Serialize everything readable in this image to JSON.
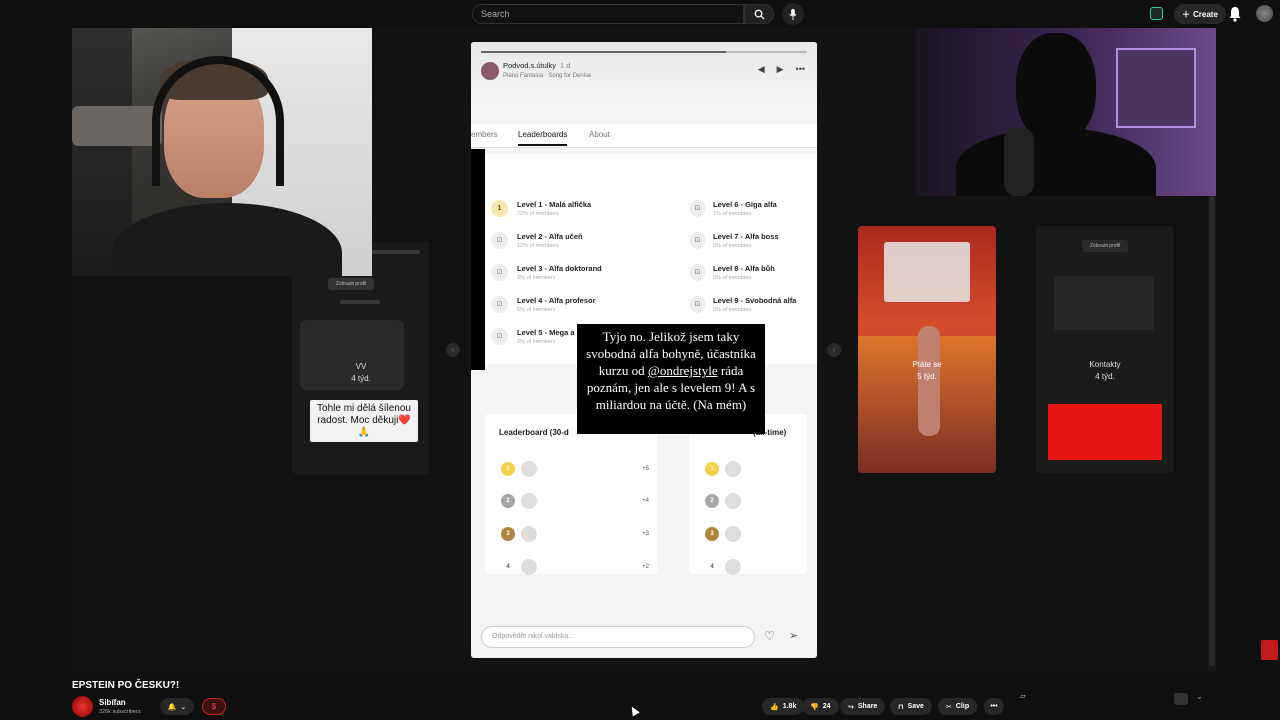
{
  "topbar": {
    "search_placeholder": "Search",
    "create_label": "Create",
    "icons": [
      "search-icon",
      "mic-icon",
      "extension-icon",
      "bell-icon",
      "profile-avatar"
    ]
  },
  "story": {
    "username": "Podvod.s.útulky",
    "time": "1 d",
    "song": "Piano Fantasia · Song for Denise",
    "tabs": [
      "embers",
      "Leaderboards",
      "About"
    ],
    "levels_left": [
      {
        "name": "Level 1 - Malá alfička",
        "sub": "72% of members",
        "icon": "1"
      },
      {
        "name": "Level 2 - Alfa učeň",
        "sub": "12% of members",
        "icon": "lock"
      },
      {
        "name": "Level 3 - Alfa doktorand",
        "sub": "8% of members",
        "icon": "lock"
      },
      {
        "name": "Level 4 - Alfa profesor",
        "sub": "5% of members",
        "icon": "lock"
      },
      {
        "name": "Level 5 - Mega a",
        "sub": "2% of members",
        "icon": "lock"
      }
    ],
    "levels_right": [
      {
        "name": "Level 6 - Giga alfa",
        "sub": "1% of members",
        "icon": "lock"
      },
      {
        "name": "Level 7 - Alfa boss",
        "sub": "0% of members",
        "icon": "lock"
      },
      {
        "name": "Level 8 - Alfa bůh",
        "sub": "0% of members",
        "icon": "lock"
      },
      {
        "name": "Level 9 - Svobodná alfa",
        "sub": "0% of members",
        "icon": "lock"
      }
    ],
    "overlay_text_pre": "Tyjo no. Jelikož jsem taky svobodná alfa bohyně, účastníka kurzu od ",
    "overlay_mention": "@ondrejstyle",
    "overlay_text_post": " ráda poznám, jen ale s levelem 9! A s miliardou na účtě. (Na mém)",
    "board_left_title": "Leaderboard (30-d",
    "board_right_title": "(all-time)",
    "board_left_points": [
      "+5",
      "+4",
      "+3",
      "+2"
    ],
    "board_ranks": [
      "1",
      "2",
      "3",
      "4"
    ],
    "reply_placeholder": "Odpovědět nikol.valdska..."
  },
  "side_stories": {
    "left": {
      "tag": "Zobrazit profil",
      "user": "VV",
      "time": "4 týd.",
      "caption": "Tohle mi dělá šílenou radost. Moc děkuji❤️🙏"
    },
    "middle": {
      "title": "Ptáte se",
      "time": "5 týd."
    },
    "right": {
      "tag": "Zobrazit profil",
      "title": "Kontakty",
      "time": "4 týd."
    }
  },
  "video": {
    "title": "EPSTEIN PO ČESKU?!",
    "channel": "Sibífan",
    "subscribers": "326k subscribers",
    "likes": "1.8k",
    "dislikes": "24",
    "share": "Share",
    "save": "Save",
    "clip": "Clip",
    "more": "•••"
  },
  "colors": {
    "accent_red": "#e51616",
    "bg": "#0f0f0f",
    "gold": "#f4d34a"
  }
}
